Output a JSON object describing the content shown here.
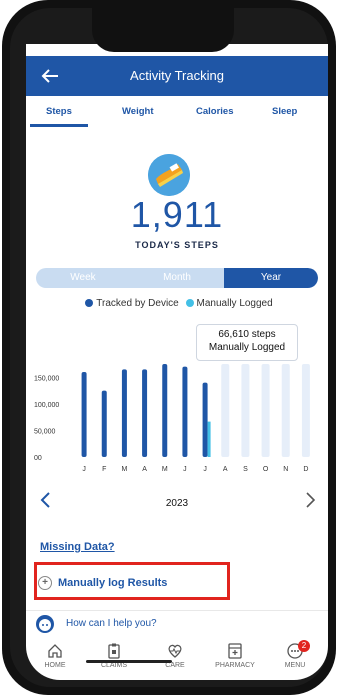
{
  "header": {
    "title": "Activity Tracking"
  },
  "tabs": [
    {
      "label": "Steps"
    },
    {
      "label": "Weight"
    },
    {
      "label": "Calories"
    },
    {
      "label": "Sleep"
    }
  ],
  "summary": {
    "count": "1,911",
    "label": "TODAY'S STEPS"
  },
  "period": {
    "options": [
      "Week",
      "Month",
      "Year"
    ],
    "selected": "Year"
  },
  "legend": {
    "device": "Tracked by Device",
    "manual": "Manually Logged"
  },
  "tooltip": {
    "line1": "66,610 steps",
    "line2": "Manually Logged"
  },
  "chart_data": {
    "type": "bar",
    "categories": [
      "J",
      "F",
      "M",
      "A",
      "M",
      "J",
      "J",
      "A",
      "S",
      "O",
      "N",
      "D"
    ],
    "series": [
      {
        "name": "Tracked by Device",
        "values": [
          160000,
          125000,
          165000,
          165000,
          175000,
          170000,
          140000,
          0,
          0,
          0,
          0,
          0
        ]
      },
      {
        "name": "Manually Logged",
        "values": [
          0,
          0,
          0,
          0,
          0,
          0,
          66610,
          0,
          0,
          0,
          0,
          0
        ]
      }
    ],
    "ylim": [
      0,
      175000
    ],
    "yticks": [
      "150,000",
      "100,000",
      "50,000",
      "00"
    ],
    "colors": {
      "device": "#1f56a6",
      "manual": "#43c0e6",
      "empty": "#e6eef9"
    }
  },
  "year_nav": {
    "year": "2023"
  },
  "links": {
    "missing": "Missing Data?",
    "manual_log": "Manually log Results"
  },
  "help": {
    "text": "How can I help you?"
  },
  "bottom_nav": [
    {
      "label": "HOME",
      "icon": "home-icon"
    },
    {
      "label": "CLAIMS",
      "icon": "clipboard-icon"
    },
    {
      "label": "CARE",
      "icon": "heart-icon"
    },
    {
      "label": "PHARMACY",
      "icon": "pharmacy-icon"
    },
    {
      "label": "MENU",
      "icon": "menu-icon",
      "badge": "2"
    }
  ]
}
